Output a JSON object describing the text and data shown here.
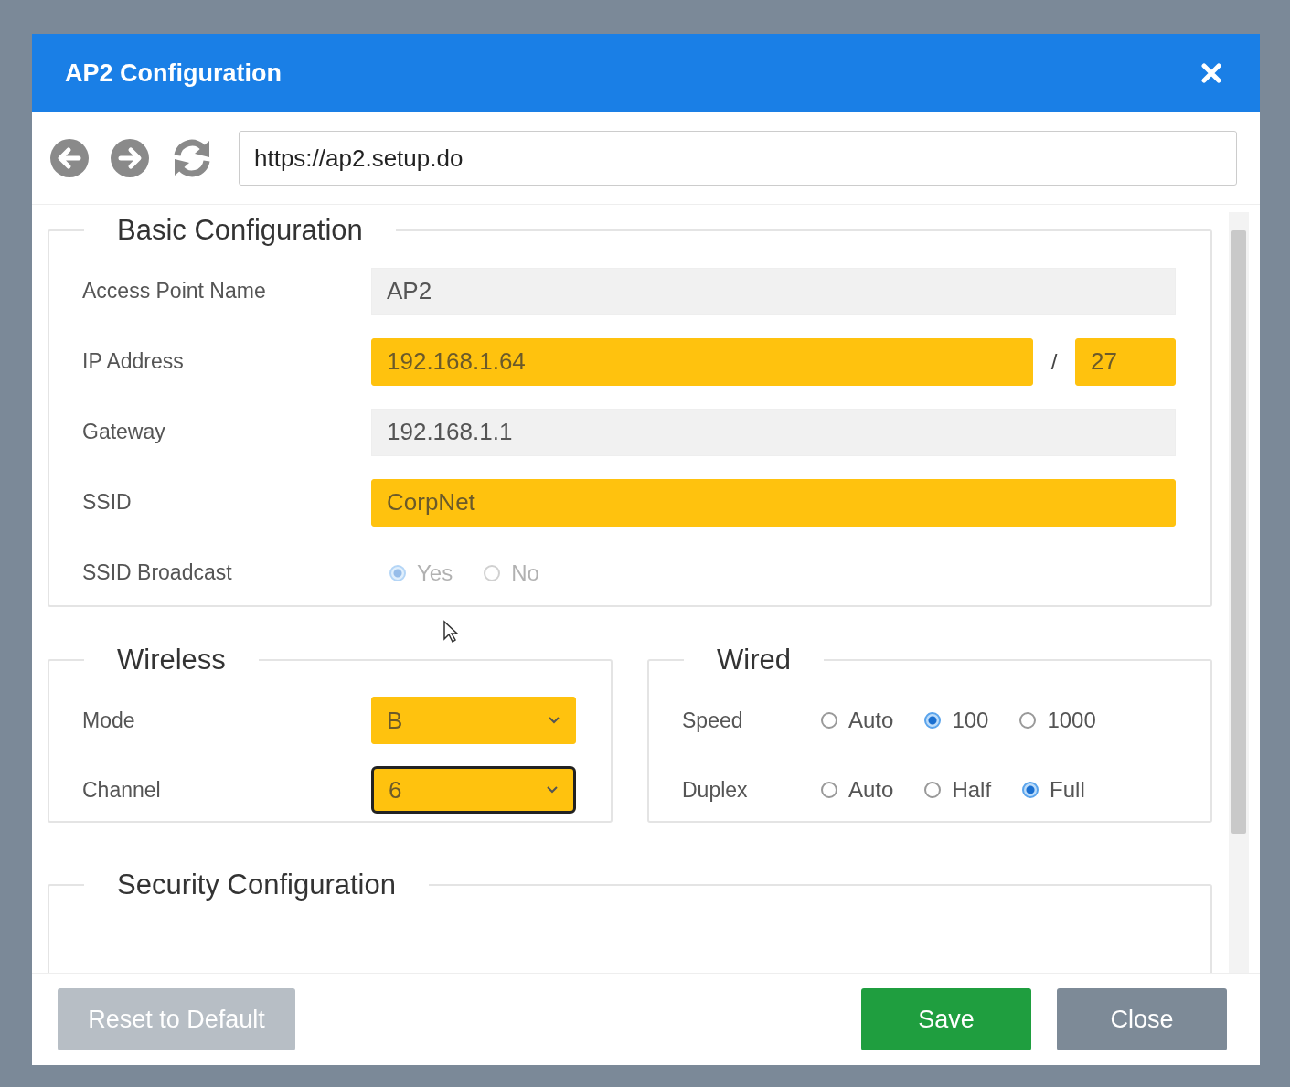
{
  "dialog": {
    "title": "AP2 Configuration"
  },
  "browser": {
    "url": "https://ap2.setup.do"
  },
  "basic": {
    "legend": "Basic Configuration",
    "fields": [
      {
        "kind": "text",
        "label": "Access Point Name",
        "value": "AP2",
        "highlighted": false,
        "disabled": true
      },
      {
        "kind": "ip",
        "label": "IP Address",
        "value": "192.168.1.64",
        "separator": "/",
        "mask": "27",
        "highlighted": true
      },
      {
        "kind": "text",
        "label": "Gateway",
        "value": "192.168.1.1",
        "highlighted": false,
        "disabled": true
      },
      {
        "kind": "text",
        "label": "SSID",
        "value": "CorpNet",
        "highlighted": true
      },
      {
        "kind": "radio",
        "label": "SSID Broadcast",
        "disabled": true,
        "options": [
          {
            "label": "Yes",
            "selected": true
          },
          {
            "label": "No",
            "selected": false
          }
        ]
      }
    ]
  },
  "wireless": {
    "legend": "Wireless",
    "fields": [
      {
        "label": "Mode",
        "value": "B",
        "highlighted": true,
        "focused": false
      },
      {
        "label": "Channel",
        "value": "6",
        "highlighted": true,
        "focused": true
      }
    ]
  },
  "wired": {
    "legend": "Wired",
    "rows": [
      {
        "label": "Speed",
        "options": [
          {
            "label": "Auto",
            "selected": false
          },
          {
            "label": "100",
            "selected": true
          },
          {
            "label": "1000",
            "selected": false
          }
        ]
      },
      {
        "label": "Duplex",
        "options": [
          {
            "label": "Auto",
            "selected": false
          },
          {
            "label": "Half",
            "selected": false
          },
          {
            "label": "Full",
            "selected": true
          }
        ]
      }
    ]
  },
  "security": {
    "legend": "Security Configuration"
  },
  "buttons": [
    {
      "kind": "reset",
      "label": "Reset to Default",
      "disabled": true
    },
    {
      "kind": "save",
      "label": "Save",
      "disabled": false
    },
    {
      "kind": "close",
      "label": "Close",
      "disabled": false
    }
  ]
}
